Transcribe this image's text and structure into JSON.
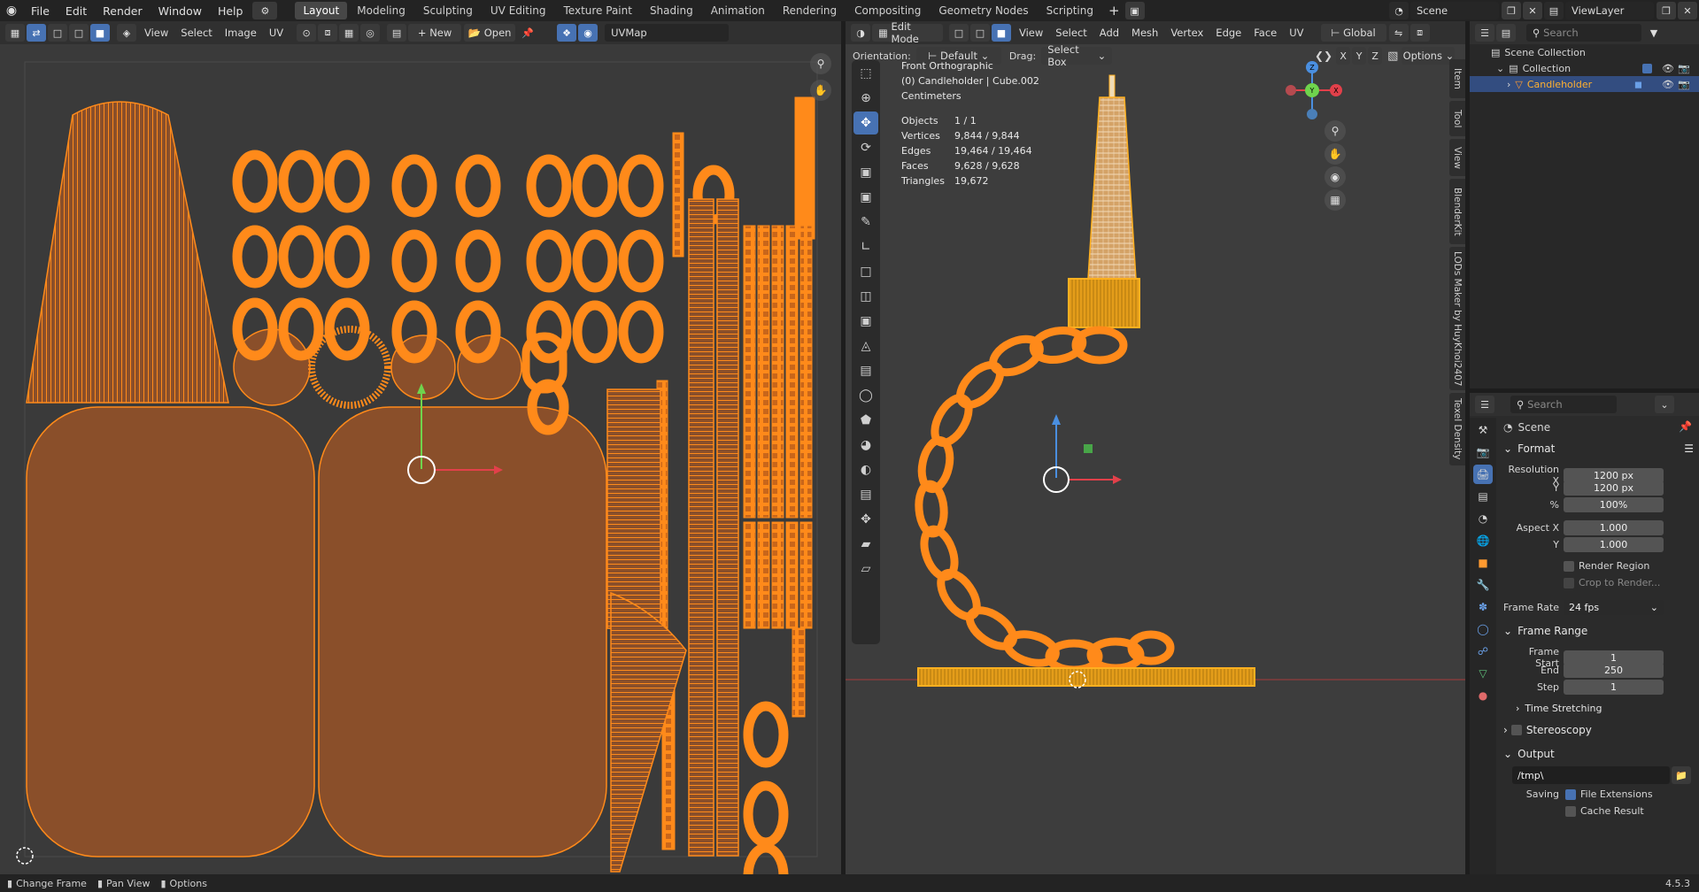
{
  "topbar": {
    "menus": [
      "File",
      "Edit",
      "Render",
      "Window",
      "Help"
    ],
    "workspaces": [
      "Layout",
      "Modeling",
      "Sculpting",
      "UV Editing",
      "Texture Paint",
      "Shading",
      "Animation",
      "Rendering",
      "Compositing",
      "Geometry Nodes",
      "Scripting"
    ],
    "active_workspace": "Layout",
    "scene": "Scene",
    "view_layer": "ViewLayer"
  },
  "uv_editor": {
    "menus": [
      "View",
      "Select",
      "Image",
      "UV"
    ],
    "new_label": "New",
    "open_label": "Open",
    "uvmap": "UVMap"
  },
  "viewport": {
    "mode": "Edit Mode",
    "menus": [
      "View",
      "Select",
      "Add",
      "Mesh",
      "Vertex",
      "Edge",
      "Face",
      "UV"
    ],
    "transform_orientation": "Global",
    "orientation_label": "Orientation:",
    "orientation_value": "Default",
    "drag_label": "Drag:",
    "drag_value": "Select Box",
    "axes": [
      "X",
      "Y",
      "Z"
    ],
    "options_label": "Options",
    "view_name": "Front Orthographic",
    "object_line": "(0) Candleholder | Cube.002",
    "units": "Centimeters",
    "stats": [
      {
        "label": "Objects",
        "value": "1 / 1"
      },
      {
        "label": "Vertices",
        "value": "9,844 / 9,844"
      },
      {
        "label": "Edges",
        "value": "19,464 / 19,464"
      },
      {
        "label": "Faces",
        "value": "9,628 / 9,628"
      },
      {
        "label": "Triangles",
        "value": "19,672"
      }
    ],
    "gizmo_labels": {
      "z": "Z",
      "y": "Y",
      "x": "X"
    },
    "side_tabs": [
      "Item",
      "Tool",
      "View",
      "BlenderKit",
      "LODs Maker by HuyKhoi2407",
      "Texel Density"
    ]
  },
  "outliner": {
    "search_placeholder": "Search",
    "scene_collection": "Scene Collection",
    "collection": "Collection",
    "object": "Candleholder"
  },
  "properties": {
    "search_placeholder": "Search",
    "context": "Scene",
    "format_panel": "Format",
    "resolution_x_label": "Resolution X",
    "resolution_x": "1200 px",
    "resolution_y_label": "Y",
    "resolution_y": "1200 px",
    "percent_label": "%",
    "percent": "100%",
    "aspect_x_label": "Aspect X",
    "aspect_x": "1.000",
    "aspect_y_label": "Y",
    "aspect_y": "1.000",
    "render_region": "Render Region",
    "crop_to_render": "Crop to Render...",
    "frame_rate_label": "Frame Rate",
    "frame_rate": "24 fps",
    "frame_range_panel": "Frame Range",
    "frame_start_label": "Frame Start",
    "frame_start": "1",
    "end_label": "End",
    "end": "250",
    "step_label": "Step",
    "step": "1",
    "time_stretching": "Time Stretching",
    "stereoscopy": "Stereoscopy",
    "output_panel": "Output",
    "output_path": "/tmp\\",
    "saving_label": "Saving",
    "file_extensions": "File Extensions",
    "cache_result": "Cache Result"
  },
  "statusbar": {
    "change_frame": "Change Frame",
    "pan_view": "Pan View",
    "options": "Options",
    "version": "4.5.3"
  },
  "colors": {
    "accent": "#4772b3",
    "uv_orange": "#ff8a1a",
    "uv_fill": "#8a4f2a",
    "viewport_bg": "#3d3d3d"
  }
}
